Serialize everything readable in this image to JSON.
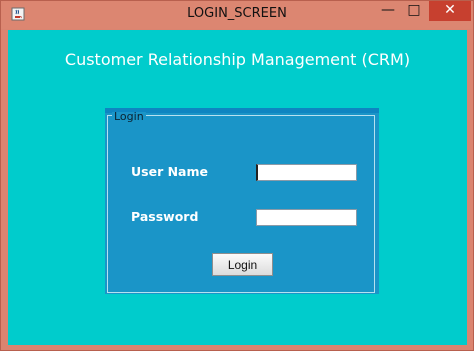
{
  "window": {
    "title": "LOGIN_SCREEN",
    "minimize_glyph": "—",
    "maximize_glyph": "□",
    "close_glyph": "✕",
    "icon": "java-coffee-icon"
  },
  "header": {
    "title": "Customer Relationship Management (CRM)"
  },
  "login_panel": {
    "group_title": "Login",
    "username_label": "User Name",
    "username_value": "",
    "password_label": "Password",
    "password_value": "",
    "login_button": "Login"
  },
  "colors": {
    "window_frame": "#db8470",
    "client_background": "#00cccc",
    "panel_background": "#1a95c8",
    "close_button": "#c7402f"
  }
}
